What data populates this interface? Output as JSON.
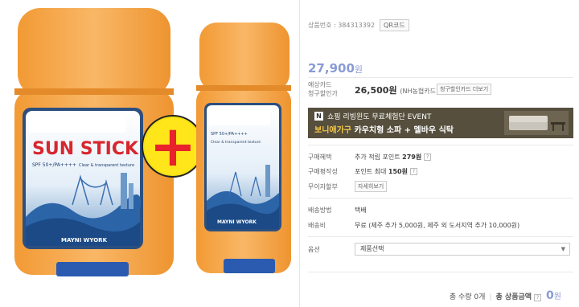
{
  "product_image": {
    "left_stick": {
      "brand": "SUN STICK",
      "spf": "SPF 50+/PA++++",
      "texture": "Clear & transparent texture",
      "maker": "MAYNI WYORK"
    },
    "right_stick": {
      "spf": "SPF 50+/PA++++",
      "texture": "Clear & transparent texture",
      "maker": "MAYNI WYORK"
    },
    "plus_symbol": "+"
  },
  "info": {
    "product_code_label": "상품번호 : 384313392",
    "qr_button": "QR코드",
    "price": "27,900",
    "price_unit": "원",
    "card_label_line1": "예상카드",
    "card_label_line2": "청구할인가",
    "card_price": "26,500원",
    "card_note": "(NH농협카드)",
    "card_button": "청구할인카드 더보기",
    "banner": {
      "badge": "N",
      "line1": "쇼핑 리빙윈도 무료체험단 EVENT",
      "line2_highlight": "보니애가구",
      "line2_rest": " 카우치형 소파 + 멜바우 식탁"
    },
    "benefit_label": "구매혜택",
    "benefit_prefix": "추가 적립 포인트 ",
    "benefit_value": "279원",
    "review_label": "구매평작성",
    "review_prefix": "포인트 최대 ",
    "review_value": "150원",
    "installment_label": "무이자할부",
    "installment_button": "자세히보기",
    "shipping_method_label": "배송방법",
    "shipping_method_value": "택배",
    "shipping_fee_label": "배송비",
    "shipping_fee_value": "무료 (제주 추가 5,000원, 제주 외 도서지역 추가 10,000원)",
    "option_label": "옵션",
    "option_selected": "제품선택",
    "total_qty_label": "총 수량 0개",
    "total_amount_label": "총 상품금액",
    "total_amount": "0",
    "total_amount_unit": "원"
  },
  "colors": {
    "accent_price": "#8a9bd4",
    "banner_bg": "#564f3d",
    "cap_orange": "#f5a446",
    "label_blue": "#a7c4e4",
    "plus_red": "#e8232b",
    "plus_yellow": "#ffe61a"
  }
}
